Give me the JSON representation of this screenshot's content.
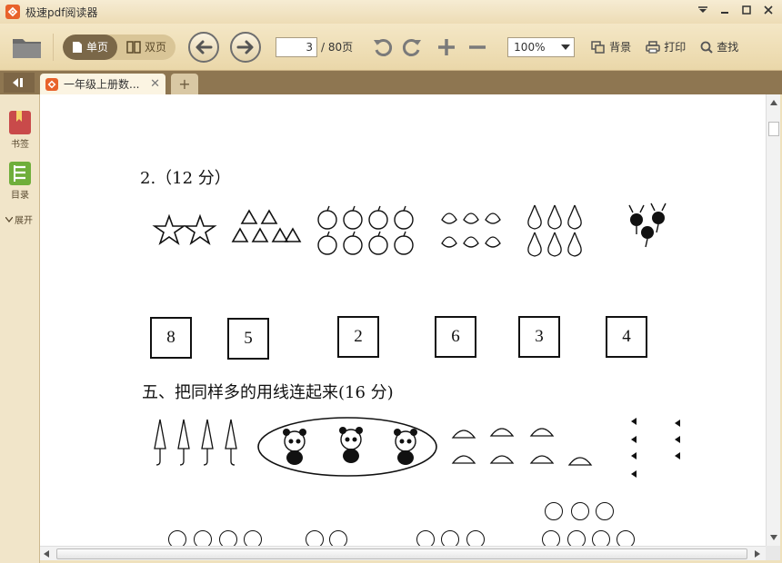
{
  "window": {
    "title": "极速pdf阅读器"
  },
  "toolbar": {
    "single_page": "单页",
    "double_page": "双页",
    "current_page": "3",
    "total_pages": "/ 80页",
    "zoom": "100%",
    "background": "背景",
    "print": "打印",
    "search": "查找"
  },
  "tabs": [
    {
      "label": "一年级上册数..."
    }
  ],
  "sidebar": {
    "bookmark": "书签",
    "toc": "目录",
    "expand": "展开"
  },
  "document": {
    "q2_heading": "2.（12 分）",
    "numbers": [
      "8",
      "5",
      "2",
      "6",
      "3",
      "4"
    ],
    "section5_heading": "五、把同样多的用线连起来(16 分)"
  },
  "colors": {
    "accent": "#e8622b",
    "tab_bar": "#8e7651",
    "toolbar": "#ead7a9"
  }
}
